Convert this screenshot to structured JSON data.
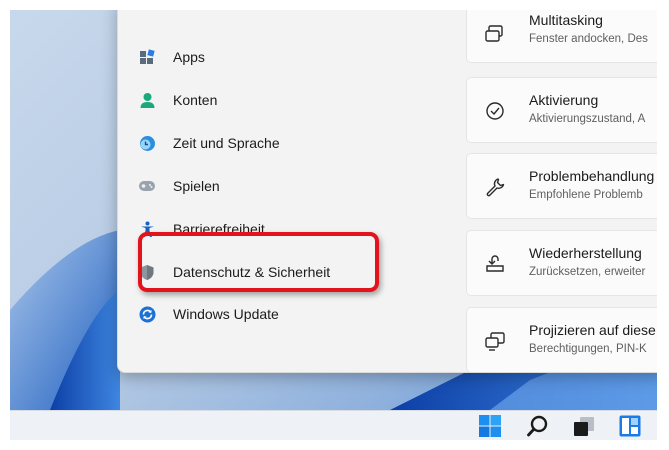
{
  "sidebar": {
    "items": [
      {
        "label": "Apps",
        "icon": "apps-icon"
      },
      {
        "label": "Konten",
        "icon": "accounts-icon"
      },
      {
        "label": "Zeit und Sprache",
        "icon": "globe-clock-icon"
      },
      {
        "label": "Spielen",
        "icon": "gamepad-icon"
      },
      {
        "label": "Barrierefreiheit",
        "icon": "accessibility-icon"
      },
      {
        "label": "Datenschutz & Sicherheit",
        "icon": "shield-icon"
      },
      {
        "label": "Windows Update",
        "icon": "windows-update-icon"
      }
    ]
  },
  "cards": [
    {
      "title": "Multitasking",
      "subtitle": "Fenster andocken, Des",
      "icon": "snap-windows-icon"
    },
    {
      "title": "Aktivierung",
      "subtitle": "Aktivierungszustand, A",
      "icon": "check-circle-icon"
    },
    {
      "title": "Problembehandlung",
      "subtitle": "Empfohlene Problemb",
      "icon": "wrench-icon"
    },
    {
      "title": "Wiederherstellung",
      "subtitle": "Zurücksetzen, erweiter",
      "icon": "recovery-icon"
    },
    {
      "title": "Projizieren auf diese",
      "subtitle": "Berechtigungen, PIN-K",
      "icon": "project-icon"
    }
  ],
  "taskbar": {
    "icons": [
      "windows-start-icon",
      "search-icon",
      "task-view-icon",
      "widgets-icon"
    ]
  },
  "colors": {
    "highlight": "#e2141b",
    "accent": "#0067c0"
  }
}
